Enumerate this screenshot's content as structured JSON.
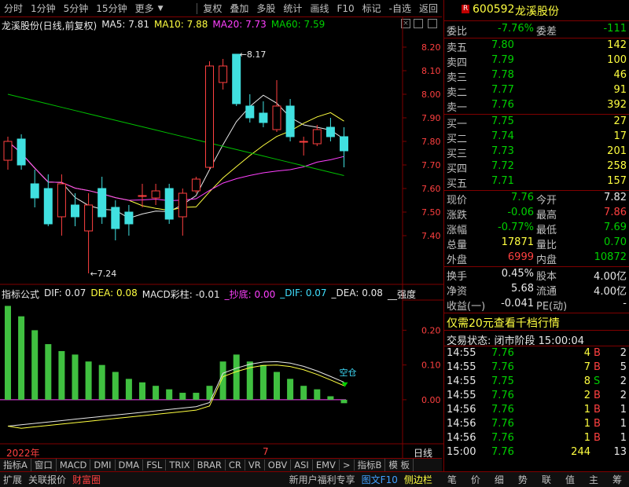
{
  "toolbar": {
    "left": [
      "分时",
      "1分钟",
      "5分钟",
      "15分钟",
      "更多"
    ],
    "right": [
      "复权",
      "叠加",
      "多股",
      "统计",
      "画线",
      "F10",
      "标记",
      "-自选",
      "返回"
    ]
  },
  "chart_title": {
    "stock": "龙溪股份(日线,前复权)",
    "ma5": "MA5: 7.81",
    "ma10": "MA10: 7.88",
    "ma20": "MA20: 7.73",
    "ma60": "MA60: 7.59"
  },
  "indicator_title": {
    "name": "指标公式",
    "dif": "DIF: 0.07",
    "dea": "DEA: 0.08",
    "macd": "MACD彩柱: -0.01",
    "chaodi": "_抄底: 0.00",
    "dif2": "_DIF: 0.07",
    "dea2": "_DEA: 0.08",
    "qiangdu": "__强度"
  },
  "chart_data": [
    {
      "type": "candlestick",
      "yticks": [
        "8.20",
        "8.10",
        "8.00",
        "7.90",
        "7.80",
        "7.70",
        "7.60",
        "7.50",
        "7.40"
      ],
      "ylim": [
        7.24,
        8.24
      ],
      "annotations": {
        "high": "8.17",
        "low": "7.24"
      },
      "candles": [
        {
          "o": 7.72,
          "c": 7.8,
          "h": 7.82,
          "l": 7.68
        },
        {
          "o": 7.81,
          "c": 7.7,
          "h": 7.83,
          "l": 7.68
        },
        {
          "o": 7.62,
          "c": 7.56,
          "h": 7.68,
          "l": 7.52
        },
        {
          "o": 7.6,
          "c": 7.45,
          "h": 7.66,
          "l": 7.44
        },
        {
          "o": 7.48,
          "c": 7.62,
          "h": 7.66,
          "l": 7.4
        },
        {
          "o": 7.53,
          "c": 7.48,
          "h": 7.58,
          "l": 7.44
        },
        {
          "o": 7.42,
          "c": 7.53,
          "h": 7.58,
          "l": 7.24
        },
        {
          "o": 7.6,
          "c": 7.48,
          "h": 7.65,
          "l": 7.45
        },
        {
          "o": 7.52,
          "c": 7.43,
          "h": 7.55,
          "l": 7.38
        },
        {
          "o": 7.5,
          "c": 7.45,
          "h": 7.53,
          "l": 7.4
        },
        {
          "o": 7.57,
          "c": 7.57,
          "h": 7.62,
          "l": 7.52
        },
        {
          "o": 7.56,
          "c": 7.59,
          "h": 7.62,
          "l": 7.53
        },
        {
          "o": 7.6,
          "c": 7.47,
          "h": 7.62,
          "l": 7.45
        },
        {
          "o": 7.48,
          "c": 7.58,
          "h": 7.6,
          "l": 7.4
        },
        {
          "o": 7.59,
          "c": 7.64,
          "h": 7.65,
          "l": 7.58
        },
        {
          "o": 7.69,
          "c": 8.12,
          "h": 8.14,
          "l": 7.68
        },
        {
          "o": 8.05,
          "c": 8.12,
          "h": 8.15,
          "l": 8.02
        },
        {
          "o": 8.17,
          "c": 7.96,
          "h": 8.17,
          "l": 7.95
        },
        {
          "o": 7.95,
          "c": 7.9,
          "h": 8.0,
          "l": 7.88
        },
        {
          "o": 7.92,
          "c": 7.88,
          "h": 7.97,
          "l": 7.86
        },
        {
          "o": 7.85,
          "c": 7.95,
          "h": 8.06,
          "l": 7.84
        },
        {
          "o": 7.95,
          "c": 7.82,
          "h": 7.98,
          "l": 7.8
        },
        {
          "o": 7.8,
          "c": 7.8,
          "h": 7.82,
          "l": 7.74
        },
        {
          "o": 7.79,
          "c": 7.85,
          "h": 7.87,
          "l": 7.78
        },
        {
          "o": 7.86,
          "c": 7.82,
          "h": 7.9,
          "l": 7.8
        },
        {
          "o": 7.82,
          "c": 7.76,
          "h": 7.86,
          "l": 7.69
        }
      ]
    },
    {
      "type": "bar",
      "yticks": [
        "0.20",
        "0.10",
        "0.00"
      ],
      "ylim": [
        -0.12,
        0.28
      ],
      "annotation": "空仓",
      "macd_bars": [
        0.27,
        0.24,
        0.2,
        0.16,
        0.14,
        0.13,
        0.11,
        0.1,
        0.08,
        0.06,
        0.05,
        0.04,
        0.03,
        0.02,
        0.02,
        0.04,
        0.11,
        0.13,
        0.11,
        0.1,
        0.08,
        0.06,
        0.04,
        0.03,
        0.01,
        -0.01
      ]
    }
  ],
  "bottom_tabs": [
    "指标A",
    "窗口",
    "MACD",
    "DMI",
    "DMA",
    "FSL",
    "TRIX",
    "BRAR",
    "CR",
    "VR",
    "OBV",
    "ASI",
    "EMV",
    ">",
    "指标B",
    "模 板"
  ],
  "bottom_axis": {
    "year": "2022年",
    "month": "7",
    "period": "日线"
  },
  "status_bar": {
    "left": [
      "扩展",
      "关联报价",
      "财富圈"
    ],
    "right": [
      "新用户福利专享",
      "图文F10",
      "侧边栏"
    ],
    "panel_tabs": [
      "笔",
      "价",
      "细",
      "势",
      "联",
      "值",
      "主",
      "筹"
    ]
  },
  "quote": {
    "badge": "R",
    "code": "600592",
    "name": "龙溪股份",
    "weibi_label": "委比",
    "weibi": "-7.76%",
    "weicha_label": "委差",
    "weicha": "-111",
    "asks": [
      {
        "label": "卖五",
        "price": "7.80",
        "vol": "142"
      },
      {
        "label": "卖四",
        "price": "7.79",
        "vol": "100"
      },
      {
        "label": "卖三",
        "price": "7.78",
        "vol": "46"
      },
      {
        "label": "卖二",
        "price": "7.77",
        "vol": "91"
      },
      {
        "label": "卖一",
        "price": "7.76",
        "vol": "392"
      }
    ],
    "bids": [
      {
        "label": "买一",
        "price": "7.75",
        "vol": "27"
      },
      {
        "label": "买二",
        "price": "7.74",
        "vol": "17"
      },
      {
        "label": "买三",
        "price": "7.73",
        "vol": "201"
      },
      {
        "label": "买四",
        "price": "7.72",
        "vol": "258"
      },
      {
        "label": "买五",
        "price": "7.71",
        "vol": "157"
      }
    ],
    "stats": [
      {
        "l1": "现价",
        "v1": "7.76",
        "c1": "green",
        "l2": "今开",
        "v2": "7.82",
        "c2": "white"
      },
      {
        "l1": "涨跌",
        "v1": "-0.06",
        "c1": "green",
        "l2": "最高",
        "v2": "7.86",
        "c2": "red"
      },
      {
        "l1": "涨幅",
        "v1": "-0.77%",
        "c1": "green",
        "l2": "最低",
        "v2": "7.69",
        "c2": "green"
      },
      {
        "l1": "总量",
        "v1": "17871",
        "c1": "yellow",
        "l2": "量比",
        "v2": "0.70",
        "c2": "green"
      },
      {
        "l1": "外盘",
        "v1": "6999",
        "c1": "red",
        "l2": "内盘",
        "v2": "10872",
        "c2": "green"
      }
    ],
    "stats2": [
      {
        "l1": "换手",
        "v1": "0.45%",
        "l2": "股本",
        "v2": "4.00亿"
      },
      {
        "l1": "净资",
        "v1": "5.68",
        "l2": "流通",
        "v2": "4.00亿"
      },
      {
        "l1": "收益(一)",
        "v1": "-0.041",
        "l2": "PE(动)",
        "v2": "-"
      }
    ],
    "promo": "仅需20元查看千档行情",
    "trade_status": "交易状态: 闭市阶段 15:00:04",
    "ticks": [
      {
        "t": "14:55",
        "p": "7.76",
        "v": "4",
        "bs": "B",
        "n": "2"
      },
      {
        "t": "14:55",
        "p": "7.76",
        "v": "7",
        "bs": "B",
        "n": "5"
      },
      {
        "t": "14:55",
        "p": "7.75",
        "v": "8",
        "bs": "S",
        "n": "2"
      },
      {
        "t": "14:55",
        "p": "7.76",
        "v": "2",
        "bs": "B",
        "n": "2"
      },
      {
        "t": "14:56",
        "p": "7.76",
        "v": "1",
        "bs": "B",
        "n": "1"
      },
      {
        "t": "14:56",
        "p": "7.76",
        "v": "1",
        "bs": "B",
        "n": "1"
      },
      {
        "t": "14:56",
        "p": "7.76",
        "v": "1",
        "bs": "B",
        "n": "1"
      },
      {
        "t": "15:00",
        "p": "7.76",
        "v": "244",
        "bs": "",
        "n": "13"
      }
    ]
  }
}
